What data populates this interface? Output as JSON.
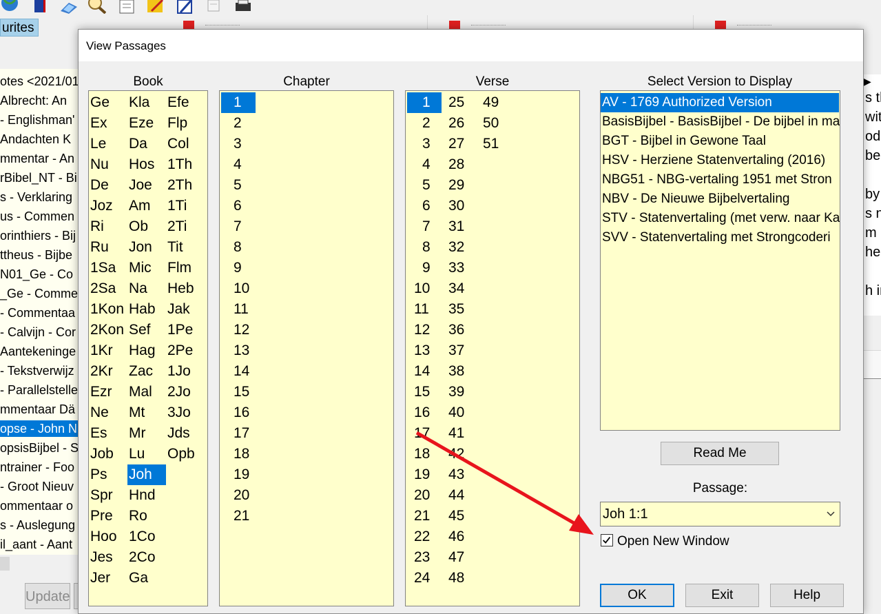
{
  "background": {
    "favorites_tab": "urites",
    "left_list": [
      "otes <2021/01",
      " Albrecht: An",
      "- Englishman'",
      " Andachten K",
      "mmentar - An",
      "rBibel_NT - Bi",
      "s - Verklaring",
      "us - Commen",
      "orinthiers - Bij",
      "ttheus - Bijbe",
      "N01_Ge - Co",
      "_Ge - Commer",
      "- Commentaa",
      "- Calvijn - Cor",
      "Aantekeninge",
      "- Tekstverwijz",
      "- Parallelstelle",
      "mmentaar Dä",
      "opse - John N",
      "opsisBijbel - S",
      "ntrainer - Foo",
      "- Groot Nieuv",
      "ommentaar o",
      "s - Auslegung",
      "il_aant - Aant"
    ],
    "left_selected_index": 18,
    "update_label": "Update",
    "right_text": [
      "s th",
      "with",
      "od",
      "be",
      "",
      "by",
      "s no",
      "m",
      "he",
      "",
      "h in"
    ]
  },
  "dialog": {
    "title": "View Passages",
    "book_header": "Book",
    "chapter_header": "Chapter",
    "verse_header": "Verse",
    "version_header": "Select Version to Display",
    "books": [
      [
        "Ge",
        "Ex",
        "Le",
        "Nu",
        "De",
        "Joz",
        "Ri",
        "Ru",
        "1Sa",
        "2Sa",
        "1Kon",
        "2Kon",
        "1Kr",
        "2Kr",
        "Ezr",
        "Ne",
        "Es",
        "Job",
        "Ps",
        "Spr",
        "Pre",
        "Hoo",
        "Jes",
        "Jer"
      ],
      [
        "Kla",
        "Eze",
        "Da",
        "Hos",
        "Joe",
        "Am",
        "Ob",
        "Jon",
        "Mic",
        "Na",
        "Hab",
        "Sef",
        "Hag",
        "Zac",
        "Mal",
        "Mt",
        "Mr",
        "Lu",
        "Joh",
        "Hnd",
        "Ro",
        "1Co",
        "2Co",
        "Ga"
      ],
      [
        "Efe",
        "Flp",
        "Col",
        "1Th",
        "2Th",
        "1Ti",
        "2Ti",
        "Tit",
        "Flm",
        "Heb",
        "Jak",
        "1Pe",
        "2Pe",
        "1Jo",
        "2Jo",
        "3Jo",
        "Jds",
        "Opb"
      ]
    ],
    "selected_book": "Joh",
    "chapters": [
      "1",
      "2",
      "3",
      "4",
      "5",
      "6",
      "7",
      "8",
      "9",
      "10",
      "11",
      "12",
      "13",
      "14",
      "15",
      "16",
      "17",
      "18",
      "19",
      "20",
      "21"
    ],
    "selected_chapter": "1",
    "verses": [
      [
        "1",
        "2",
        "3",
        "4",
        "5",
        "6",
        "7",
        "8",
        "9",
        "10",
        "11",
        "12",
        "13",
        "14",
        "15",
        "16",
        "17",
        "18",
        "19",
        "20",
        "21",
        "22",
        "23",
        "24"
      ],
      [
        "25",
        "26",
        "27",
        "28",
        "29",
        "30",
        "31",
        "32",
        "33",
        "34",
        "35",
        "36",
        "37",
        "38",
        "39",
        "40",
        "41",
        "42",
        "43",
        "44",
        "45",
        "46",
        "47",
        "48"
      ],
      [
        "49",
        "50",
        "51"
      ]
    ],
    "selected_verse": "1",
    "versions": [
      "AV - 1769 Authorized Version",
      "BasisBijbel - BasisBijbel - De bijbel in ma",
      "BGT - Bijbel in Gewone Taal",
      "HSV - Herziene Statenvertaling (2016)",
      "NBG51 - NBG-vertaling 1951 met Stron",
      "NBV - De Nieuwe Bijbelvertaling",
      "STV - Statenvertaling (met verw. naar Ka",
      "SVV - Statenvertaling met Strongcoderi"
    ],
    "selected_version_index": 0,
    "read_me_label": "Read Me",
    "passage_label": "Passage:",
    "passage_value": "Joh 1:1",
    "open_new_window_label": "Open New Window",
    "open_new_window_checked": true,
    "ok_label": "OK",
    "exit_label": "Exit",
    "help_label": "Help"
  },
  "colors": {
    "list_background": "#ffffcc",
    "selection": "#0078d7",
    "annotation_arrow": "#e8141c"
  }
}
